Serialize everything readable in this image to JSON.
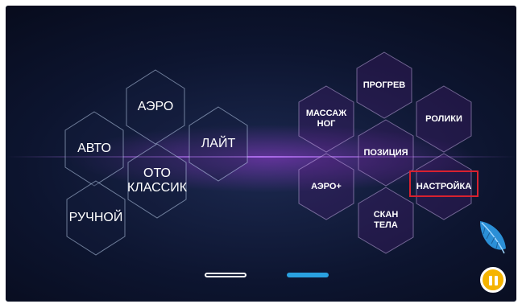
{
  "modes": {
    "avto": "АВТО",
    "aero": "АЭРО",
    "lait": "ЛАЙТ",
    "oto_klassik": "ОТО\nКЛАССИК",
    "ruchnoi": "РУЧНОЙ"
  },
  "settings": {
    "progrev": "ПРОГРЕВ",
    "massazh_nog": "МАССАЖ\nНОГ",
    "roliki": "РОЛИКИ",
    "pozitsiya": "ПОЗИЦИЯ",
    "aero_plus": "АЭРО+",
    "nastroika": "НАСТРОЙКА",
    "skan_tela": "СКАН\nТЕЛА"
  },
  "pager": {
    "pages": 2,
    "current": 2
  },
  "colors": {
    "accent": "#2aa1e0",
    "highlight": "#d8212f",
    "pause": "#f5b400"
  },
  "icons": {
    "feather": "feather-icon",
    "pause": "pause-icon"
  }
}
